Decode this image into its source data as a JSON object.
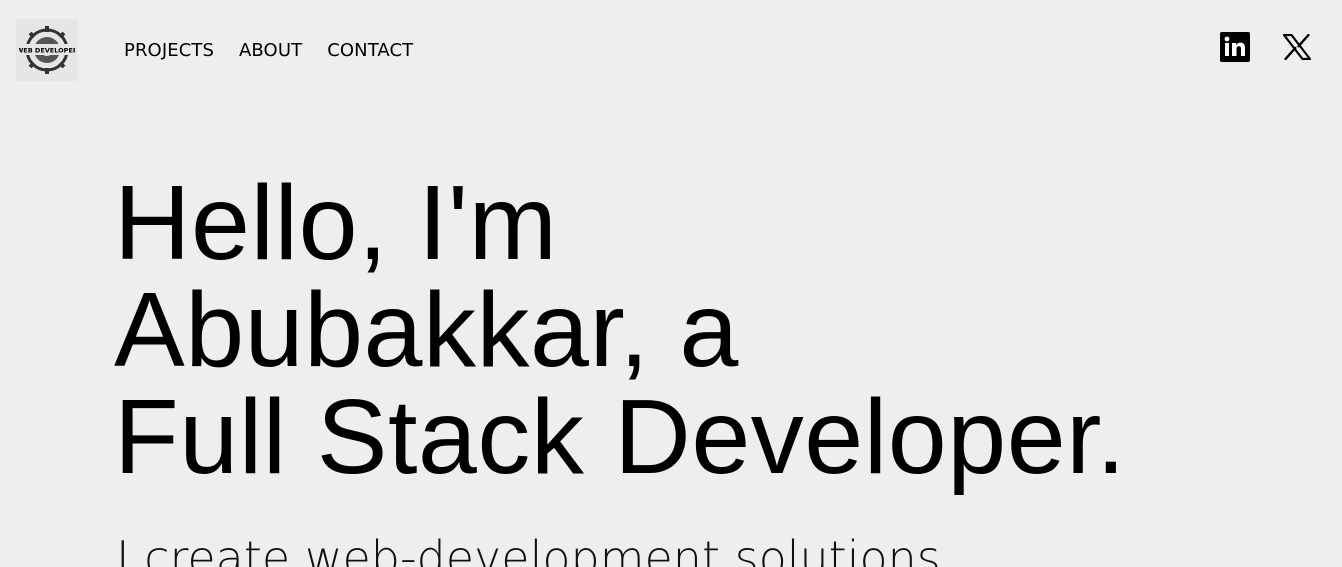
{
  "header": {
    "logo": {
      "icon": "web-developer-gear-logo",
      "text": "WEB DEVELOPER"
    },
    "nav": [
      {
        "label": "PROJECTS"
      },
      {
        "label": "ABOUT"
      },
      {
        "label": "CONTACT"
      }
    ],
    "social": [
      {
        "icon": "linkedin-icon"
      },
      {
        "icon": "x-icon"
      }
    ]
  },
  "hero": {
    "line1": "Hello, I'm",
    "line2": "Abubakkar, a",
    "line3": "Full Stack Developer.",
    "tagline": "I create web-development solutions"
  },
  "colors": {
    "background": "#eeeeee",
    "text": "#000000"
  }
}
